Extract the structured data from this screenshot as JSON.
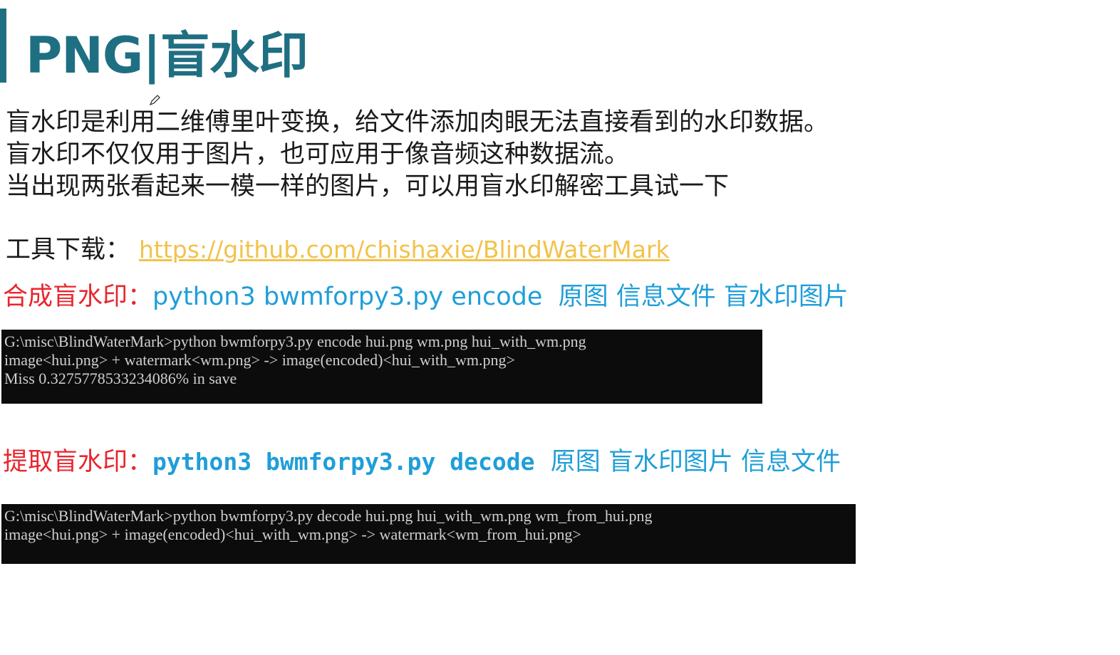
{
  "title": "PNG|盲水印",
  "paragraphs": [
    "盲水印是利用二维傅里叶变换，给文件添加肉眼无法直接看到的水印数据。",
    "盲水印不仅仅用于图片，也可应用于像音频这种数据流。",
    "当出现两张看起来一模一样的图片，可以用盲水印解密工具试一下"
  ],
  "tool": {
    "label": "工具下载：",
    "link": "https://github.com/chishaxie/BlindWaterMark"
  },
  "encode": {
    "label": "合成盲水印：",
    "command": "python3 bwmforpy3.py encode",
    "args": "原图 信息文件  盲水印图片",
    "terminal": [
      "G:\\misc\\BlindWaterMark>python bwmforpy3.py encode hui.png wm.png hui_with_wm.png",
      "image<hui.png> + watermark<wm.png> -> image(encoded)<hui_with_wm.png>",
      "Miss 0.3275778533234086% in save"
    ]
  },
  "decode": {
    "label": "提取盲水印：",
    "command": "python3 bwmforpy3.py decode",
    "args": "原图  盲水印图片 信息文件",
    "terminal": [
      "G:\\misc\\BlindWaterMark>python bwmforpy3.py decode hui.png hui_with_wm.png wm_from_hui.png",
      "image<hui.png> + image(encoded)<hui_with_wm.png> -> watermark<wm_from_hui.png>"
    ]
  },
  "colors": {
    "title": "#1f6f82",
    "label_red": "#e8262d",
    "command_blue": "#1f9ed8",
    "link": "#f2c24a",
    "terminal_bg": "#0c0c0c"
  }
}
